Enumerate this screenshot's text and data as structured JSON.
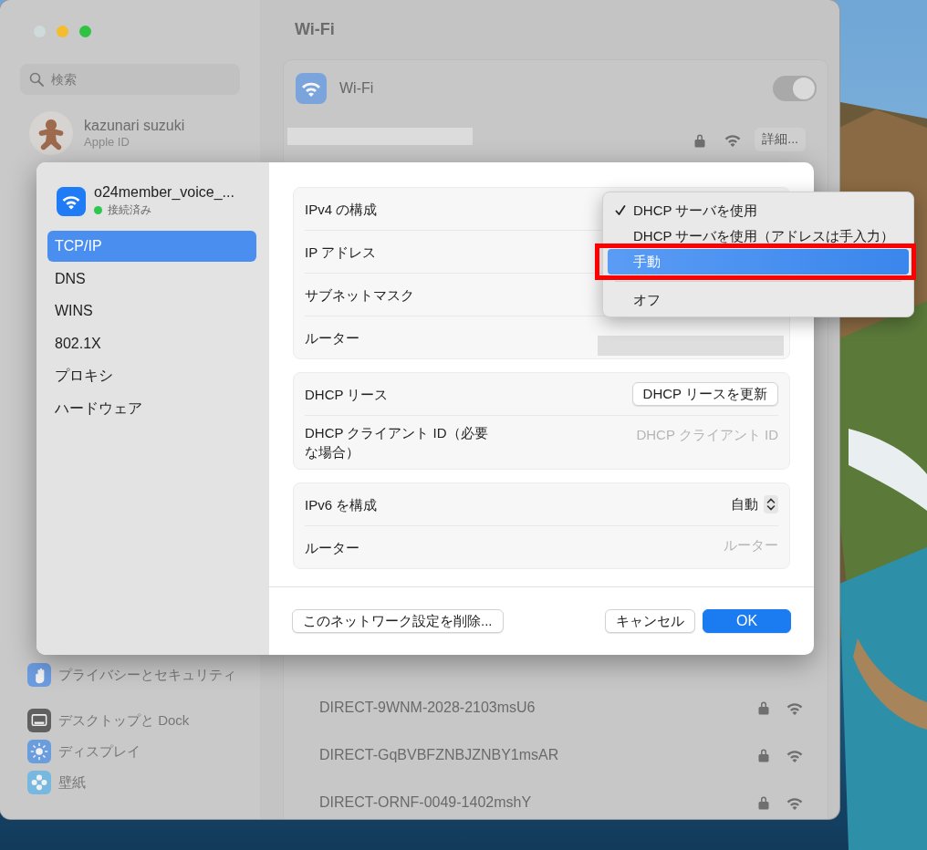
{
  "window": {
    "sidebar": {
      "search": {
        "placeholder": "検索"
      },
      "account": {
        "name": "kazunari suzuki",
        "subtitle": "Apple ID"
      },
      "groups": [
        {
          "items": [
            {
              "label": "プライバシーとセキュリティ",
              "kind": "hand"
            }
          ]
        },
        {
          "items": [
            {
              "label": "デスクトップと Dock",
              "kind": "dock"
            },
            {
              "label": "ディスプレイ",
              "kind": "sun"
            },
            {
              "label": "壁紙",
              "kind": "flower"
            }
          ]
        }
      ]
    },
    "content": {
      "title": "Wi-Fi",
      "wifi": {
        "label": "Wi-Fi",
        "on": true
      },
      "current_network": {
        "redacted": true,
        "locked": true,
        "details_button": "詳細..."
      },
      "networks": [
        {
          "name": "DIRECT-9WNM-2028-2103msU6",
          "locked": true
        },
        {
          "name": "DIRECT-GqBVBFZNBJZNBY1msAR",
          "locked": true
        },
        {
          "name": "DIRECT-ORNF-0049-1402mshY",
          "locked": true
        }
      ]
    }
  },
  "sheet": {
    "network": {
      "name": "o24member_voice_...",
      "status": "接続済み",
      "connected": true
    },
    "tabs": [
      {
        "label": "TCP/IP",
        "selected": true
      },
      {
        "label": "DNS",
        "selected": false
      },
      {
        "label": "WINS",
        "selected": false
      },
      {
        "label": "802.1X",
        "selected": false
      },
      {
        "label": "プロキシ",
        "selected": false
      },
      {
        "label": "ハードウェア",
        "selected": false
      }
    ],
    "groups": [
      {
        "rows": [
          {
            "label": "IPv4 の構成",
            "kind": "plain"
          },
          {
            "label": "IP アドレス",
            "kind": "plain"
          },
          {
            "label": "サブネットマスク",
            "kind": "plain"
          },
          {
            "label": "ルーター",
            "kind": "redacted"
          }
        ]
      },
      {
        "rows": [
          {
            "label": "DHCP リース",
            "kind": "button",
            "button": "DHCP リースを更新"
          },
          {
            "label": "DHCP クライアント ID（必要な場合）",
            "kind": "field",
            "placeholder": "DHCP クライアント ID"
          }
        ]
      },
      {
        "rows": [
          {
            "label": "IPv6 を構成",
            "kind": "popup",
            "value": "自動"
          },
          {
            "label": "ルーター",
            "kind": "field",
            "placeholder": "ルーター"
          }
        ]
      }
    ],
    "footer": {
      "delete_button": "このネットワーク設定を削除...",
      "cancel_button": "キャンセル",
      "ok_button": "OK"
    }
  },
  "menu": {
    "items": [
      {
        "label": "DHCP サーバを使用",
        "checked": true,
        "selected": false,
        "annotated": false,
        "separator_after": false
      },
      {
        "label": "DHCP サーバを使用（アドレスは手入力）",
        "checked": false,
        "selected": false,
        "annotated": false,
        "separator_after": false
      },
      {
        "label": "手動",
        "checked": false,
        "selected": true,
        "annotated": true,
        "separator_after": true
      },
      {
        "label": "オフ",
        "checked": false,
        "selected": false,
        "annotated": false,
        "separator_after": false
      }
    ]
  }
}
